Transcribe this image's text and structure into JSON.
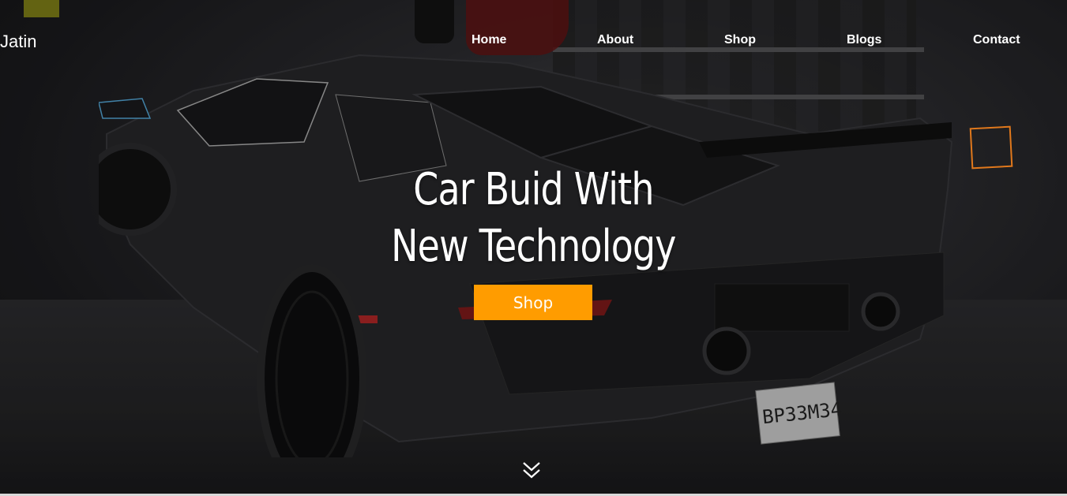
{
  "brand": {
    "logo_text": "Jatin"
  },
  "nav": {
    "items": [
      {
        "label": "Home"
      },
      {
        "label": "About"
      },
      {
        "label": "Shop"
      },
      {
        "label": "Blogs"
      },
      {
        "label": "Contact"
      }
    ]
  },
  "hero": {
    "title_line1": "Car Buid With",
    "title_line2": "New Technology",
    "cta_label": "Shop",
    "license_plate": "BP33M34",
    "scroll_icon": "double-chevron-down-icon"
  },
  "colors": {
    "accent": "#ff9c00",
    "nav_text": "#ffffff",
    "highlight_square": "#e0781c"
  }
}
